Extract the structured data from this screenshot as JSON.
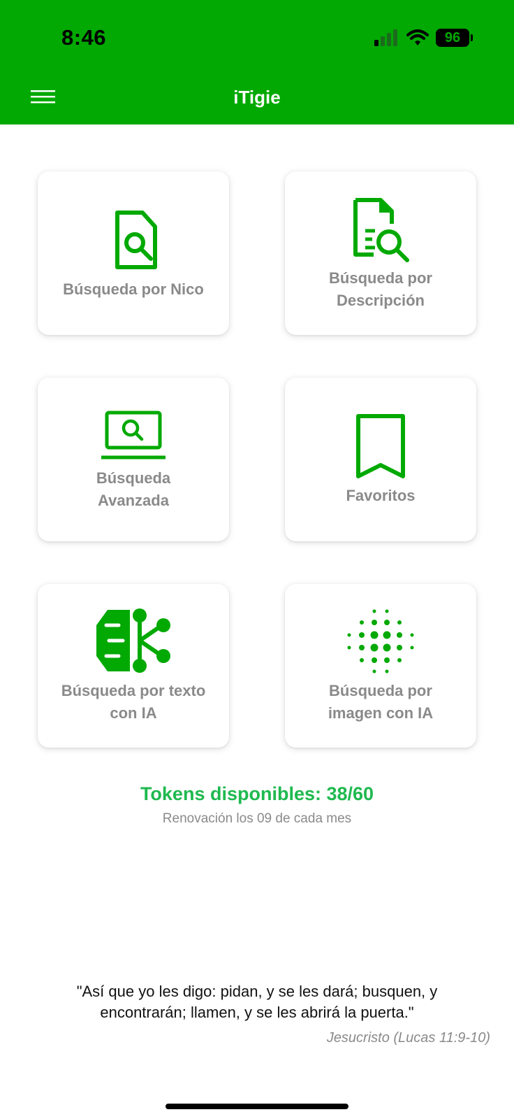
{
  "status_bar": {
    "time": "8:46",
    "battery_level": "96"
  },
  "header": {
    "title": "iTigie",
    "menu_icon": "hamburger-menu-icon"
  },
  "cards": [
    {
      "label": "Búsqueda por Nico",
      "icon": "document-search-icon"
    },
    {
      "label": "Búsqueda por\nDescripción",
      "icon": "document-lines-search-icon"
    },
    {
      "label": "Búsqueda\nAvanzada",
      "icon": "laptop-search-icon"
    },
    {
      "label": "Favoritos",
      "icon": "bookmark-icon"
    },
    {
      "label": "Búsqueda por texto\ncon IA",
      "icon": "ai-brain-network-icon"
    },
    {
      "label": "Búsqueda por\nimagen con IA",
      "icon": "dot-sphere-icon"
    }
  ],
  "tokens": {
    "text": "Tokens disponibles: 38/60",
    "renewal": "Renovación los 09 de cada mes"
  },
  "quote": {
    "text": "\"Así que yo les digo: pidan, y se les dará; busquen, y encontrarán; llamen, y se les abrirá la puerta.\"",
    "author": "Jesucristo (Lucas 11:9-10)"
  },
  "colors": {
    "brand_green": "#02a902",
    "tokens_green": "#1fb94f",
    "label_gray": "#8a8a8a"
  }
}
